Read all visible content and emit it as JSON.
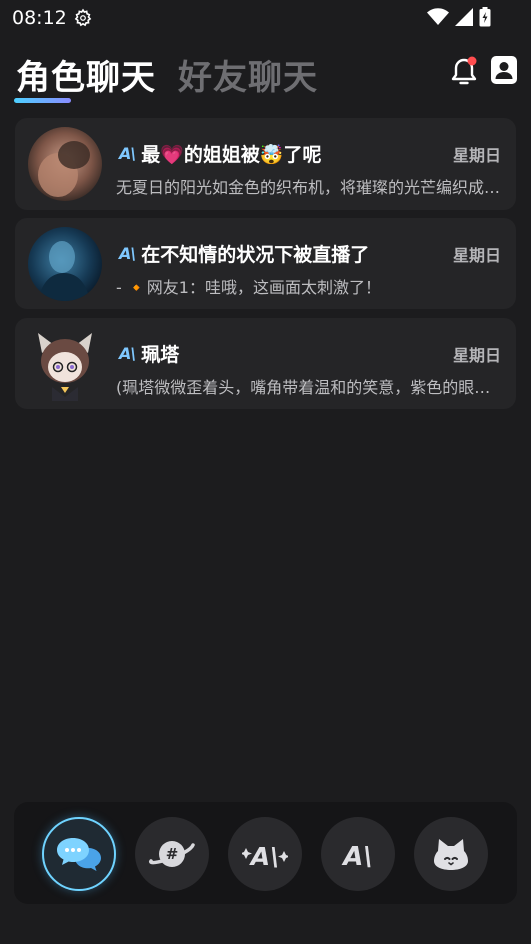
{
  "status_bar": {
    "time": "08:12"
  },
  "header": {
    "tab_active": "角色聊天",
    "tab_inactive": "好友聊天"
  },
  "chats": [
    {
      "ai_label": "A\\",
      "title": "最💗的姐姐被🤯了呢",
      "day": "星期日",
      "preview": "无夏日的阳光如金色的织布机，将璀璨的光芒编织成一幅温暖的画卷"
    },
    {
      "ai_label": "A\\",
      "title": "在不知情的状况下被直播了",
      "day": "星期日",
      "preview": "- 🔸网友1：哇哦，这画面太刺激了！"
    },
    {
      "ai_label": "A\\",
      "title": "珮塔",
      "day": "星期日",
      "preview": "(珮塔微微歪着头，嘴角带着温和的笑意，紫色的眼眸中闪烁着光芒"
    }
  ],
  "colors": {
    "accent": "#6fd3ff",
    "notification_dot": "#ff4d4f",
    "background": "#1c1c1e",
    "card": "#252527"
  },
  "icons": [
    "gear-icon",
    "wifi-icon",
    "signal-icon",
    "battery-icon",
    "bell-icon",
    "contacts-icon",
    "chat-bubbles-icon",
    "planet-hashtag-icon",
    "ai-sparkle-icon",
    "ai-logo-icon",
    "cat-mascot-icon"
  ]
}
